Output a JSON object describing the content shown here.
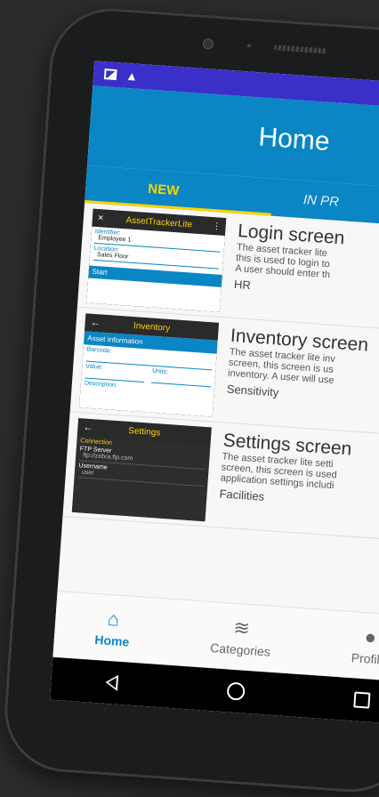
{
  "app": {
    "header_title": "Home",
    "tabs": [
      {
        "label": "NEW",
        "active": true
      },
      {
        "label": "IN PR",
        "active": false
      }
    ]
  },
  "items": [
    {
      "title": "Login screen",
      "desc_lines": [
        "The asset tracker lite",
        "this is used to login to",
        "A user should enter th"
      ],
      "tag": "HR",
      "thumb": {
        "header": "AssetTrackerLite",
        "close": "×",
        "field1_label": "Identifier:",
        "field1_value": "Employee 1",
        "field2_label": "Location:",
        "field2_value": "Sales Floor",
        "button": "Start"
      }
    },
    {
      "title": "Inventory screen",
      "desc_lines": [
        "The asset tracker lite inv",
        "screen, this screen is us",
        "inventory. A user will use"
      ],
      "tag": "Sensitivity",
      "thumb": {
        "header": "Inventory",
        "section": "Asset Information",
        "field1_label": "Barcode:",
        "field2_label": "Value:",
        "field3_label": "Units:",
        "field4_label": "Description:"
      }
    },
    {
      "title": "Settings screen",
      "desc_lines": [
        "The asset tracker lite setti",
        "screen, this screen is used",
        "application settings includi"
      ],
      "tag": "Facilities",
      "thumb": {
        "header": "Settings",
        "section": "Connection",
        "field1_label": "FTP Server",
        "field1_value": "ftp://zebra.ftp.com",
        "field2_label": "Username",
        "field2_value": "user"
      }
    }
  ],
  "bottom_nav": [
    {
      "label": "Home",
      "icon": "home-icon",
      "active": true
    },
    {
      "label": "Categories",
      "icon": "layers-icon",
      "active": false
    },
    {
      "label": "Profile",
      "icon": "person-icon",
      "active": false
    }
  ],
  "colors": {
    "primary": "#0a86c4",
    "accent": "#ffd200",
    "status_bar": "#3b2fc9"
  }
}
